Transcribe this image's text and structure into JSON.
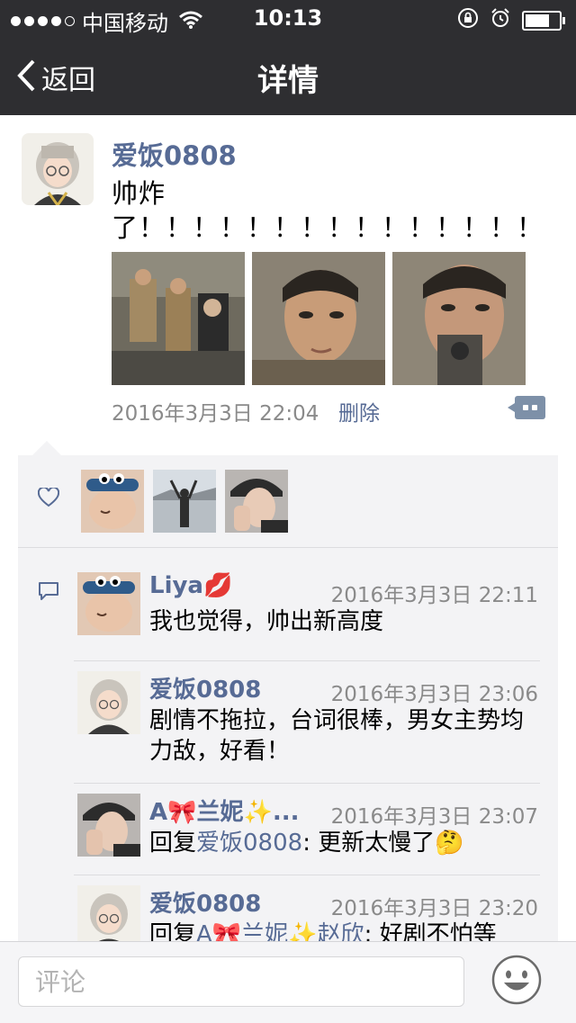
{
  "status_bar": {
    "signal_dots": 5,
    "carrier": "中国移动",
    "time": "10:13",
    "icons": [
      "wifi-icon",
      "rotation-lock-icon",
      "alarm-icon",
      "battery-icon"
    ]
  },
  "nav": {
    "back_label": "返回",
    "title": "详情"
  },
  "post": {
    "author": "爱饭0808",
    "text": "帅炸了！！！！！！！！！！！！！！！",
    "photos": [
      "photo-1",
      "photo-2",
      "photo-3"
    ],
    "timestamp": "2016年3月3日 22:04",
    "delete_label": "删除"
  },
  "likes": {
    "icon": "heart-icon",
    "avatars": [
      "liker-1",
      "liker-2",
      "liker-3"
    ]
  },
  "comments": [
    {
      "author": "Liya💋",
      "time": "2016年3月3日 22:11",
      "text": "我也觉得，帅出新高度"
    },
    {
      "author": "爱饭0808",
      "time": "2016年3月3日 23:06",
      "text": "剧情不拖拉，台词很棒，男女主势均力敌，好看！"
    },
    {
      "author": "A🎀兰妮✨...",
      "time": "2016年3月3日 23:07",
      "reply_prefix": "回复",
      "reply_to": "爱饭0808",
      "text": ": 更新太慢了🤔"
    },
    {
      "author": "爱饭0808",
      "time": "2016年3月3日 23:20",
      "reply_prefix": "回复",
      "reply_to": "A🎀兰妮✨赵欣",
      "text": ": 好剧不怕等"
    }
  ],
  "input": {
    "placeholder": "评论"
  },
  "colors": {
    "bar_bg": "#2e2e31",
    "link": "#576b95",
    "meta": "#8a8a8a",
    "panel_bg": "#f3f3f5"
  }
}
